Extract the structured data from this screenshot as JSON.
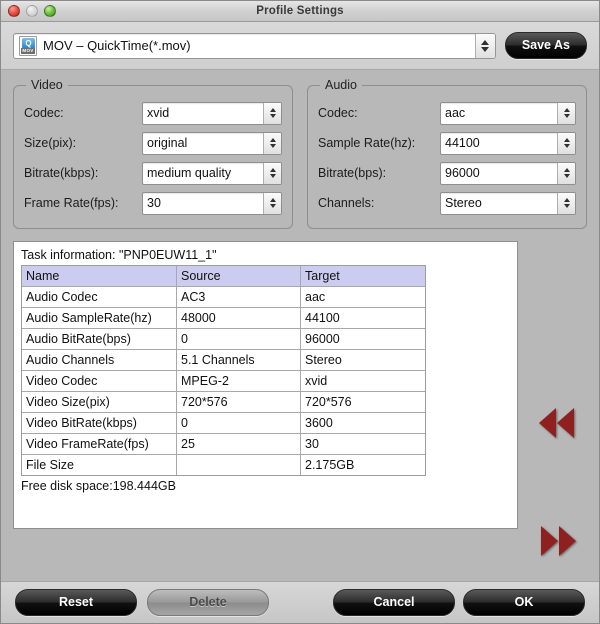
{
  "window": {
    "title": "Profile Settings",
    "controls": [
      {
        "name": "close",
        "color": "#e8544a"
      },
      {
        "name": "minimize",
        "color": "#d8d8d8"
      },
      {
        "name": "zoom",
        "color": "#6fc242"
      }
    ]
  },
  "topbar": {
    "format_icon": "quicktime-mov-file-icon",
    "format_icon_badge": "MOV",
    "format_icon_glyph": "Q",
    "format_value": "MOV – QuickTime(*.mov)",
    "save_as_label": "Save As"
  },
  "video": {
    "legend": "Video",
    "rows": [
      {
        "label": "Codec:",
        "value": "xvid"
      },
      {
        "label": "Size(pix):",
        "value": "original"
      },
      {
        "label": "Bitrate(kbps):",
        "value": "medium quality"
      },
      {
        "label": "Frame Rate(fps):",
        "value": "30"
      }
    ]
  },
  "audio": {
    "legend": "Audio",
    "rows": [
      {
        "label": "Codec:",
        "value": "aac"
      },
      {
        "label": "Sample Rate(hz):",
        "value": "44100"
      },
      {
        "label": "Bitrate(bps):",
        "value": "96000"
      },
      {
        "label": "Channels:",
        "value": "Stereo"
      }
    ]
  },
  "task": {
    "caption": "Task information: \"PNP0EUW11_1\"",
    "columns": [
      "Name",
      "Source",
      "Target"
    ],
    "header_bg": "#ccccf0",
    "rows": [
      [
        "Audio Codec",
        "AC3",
        "aac"
      ],
      [
        "Audio SampleRate(hz)",
        "48000",
        "44100"
      ],
      [
        "Audio BitRate(bps)",
        "0",
        "96000"
      ],
      [
        "Audio Channels",
        "5.1 Channels",
        "Stereo"
      ],
      [
        "Video Codec",
        "MPEG-2",
        "xvid"
      ],
      [
        "Video Size(pix)",
        "720*576",
        "720*576"
      ],
      [
        "Video BitRate(kbps)",
        "0",
        "3600"
      ],
      [
        "Video FrameRate(fps)",
        "25",
        "30"
      ],
      [
        "File Size",
        "",
        "2.175GB"
      ]
    ],
    "free_space": "Free disk space:198.444GB"
  },
  "nav": {
    "prev_icon": "double-arrow-left-icon",
    "next_icon": "double-arrow-right-icon",
    "arrow_color": "#8e2020"
  },
  "footer": {
    "reset_label": "Reset",
    "delete_label": "Delete",
    "cancel_label": "Cancel",
    "ok_label": "OK"
  }
}
